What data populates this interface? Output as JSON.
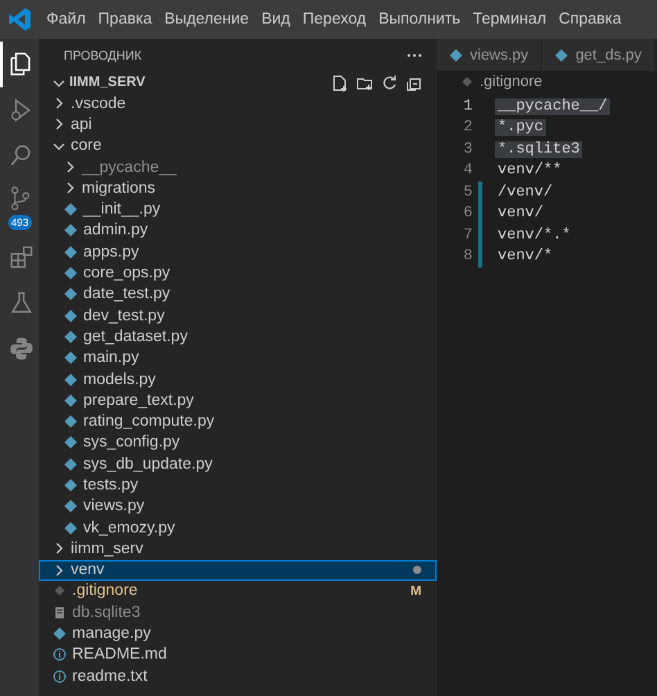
{
  "menu": [
    "Файл",
    "Правка",
    "Выделение",
    "Вид",
    "Переход",
    "Выполнить",
    "Терминал",
    "Справка"
  ],
  "activity_bar": [
    {
      "kind": "explorer",
      "selected": true
    },
    {
      "kind": "debug",
      "selected": false
    },
    {
      "kind": "search",
      "selected": false
    },
    {
      "kind": "scm",
      "selected": false,
      "badge": "493"
    },
    {
      "kind": "extensions",
      "selected": false
    },
    {
      "kind": "testing",
      "selected": false
    },
    {
      "kind": "python",
      "selected": false
    }
  ],
  "explorer": {
    "title": "ПРОВОДНИК",
    "folder": "IIMM_SERV",
    "items": [
      {
        "name": ".vscode",
        "kind": "folder",
        "expanded": false,
        "selected": false,
        "ignored": false,
        "modified": false,
        "dot": false
      },
      {
        "name": "api",
        "kind": "folder",
        "expanded": false,
        "selected": false,
        "ignored": false,
        "modified": false,
        "dot": false
      },
      {
        "name": "core",
        "kind": "folder",
        "expanded": true,
        "selected": false,
        "ignored": false,
        "modified": false,
        "dot": false,
        "children": [
          {
            "name": "__pycache__",
            "kind": "folder",
            "expanded": false,
            "selected": false,
            "ignored": true,
            "modified": false,
            "dot": false
          },
          {
            "name": "migrations",
            "kind": "folder",
            "expanded": false,
            "selected": false,
            "ignored": false,
            "modified": false,
            "dot": false
          },
          {
            "name": "__init__.py",
            "kind": "python",
            "selected": false,
            "ignored": false,
            "modified": false,
            "dot": false
          },
          {
            "name": "admin.py",
            "kind": "python",
            "selected": false,
            "ignored": false,
            "modified": false,
            "dot": false
          },
          {
            "name": "apps.py",
            "kind": "python",
            "selected": false,
            "ignored": false,
            "modified": false,
            "dot": false
          },
          {
            "name": "core_ops.py",
            "kind": "python",
            "selected": false,
            "ignored": false,
            "modified": false,
            "dot": false
          },
          {
            "name": "date_test.py",
            "kind": "python",
            "selected": false,
            "ignored": false,
            "modified": false,
            "dot": false
          },
          {
            "name": "dev_test.py",
            "kind": "python",
            "selected": false,
            "ignored": false,
            "modified": false,
            "dot": false
          },
          {
            "name": "get_dataset.py",
            "kind": "python",
            "selected": false,
            "ignored": false,
            "modified": false,
            "dot": false
          },
          {
            "name": "main.py",
            "kind": "python",
            "selected": false,
            "ignored": false,
            "modified": false,
            "dot": false
          },
          {
            "name": "models.py",
            "kind": "python",
            "selected": false,
            "ignored": false,
            "modified": false,
            "dot": false
          },
          {
            "name": "prepare_text.py",
            "kind": "python",
            "selected": false,
            "ignored": false,
            "modified": false,
            "dot": false
          },
          {
            "name": "rating_compute.py",
            "kind": "python",
            "selected": false,
            "ignored": false,
            "modified": false,
            "dot": false
          },
          {
            "name": "sys_config.py",
            "kind": "python",
            "selected": false,
            "ignored": false,
            "modified": false,
            "dot": false
          },
          {
            "name": "sys_db_update.py",
            "kind": "python",
            "selected": false,
            "ignored": false,
            "modified": false,
            "dot": false
          },
          {
            "name": "tests.py",
            "kind": "python",
            "selected": false,
            "ignored": false,
            "modified": false,
            "dot": false
          },
          {
            "name": "views.py",
            "kind": "python",
            "selected": false,
            "ignored": false,
            "modified": false,
            "dot": false
          },
          {
            "name": "vk_emozy.py",
            "kind": "python",
            "selected": false,
            "ignored": false,
            "modified": false,
            "dot": false
          }
        ]
      },
      {
        "name": "iimm_serv",
        "kind": "folder",
        "expanded": false,
        "selected": false,
        "ignored": false,
        "modified": false,
        "dot": false
      },
      {
        "name": "venv",
        "kind": "folder",
        "expanded": false,
        "selected": true,
        "ignored": false,
        "modified": false,
        "dot": true
      },
      {
        "name": ".gitignore",
        "kind": "gitignore",
        "selected": false,
        "ignored": false,
        "modified": true,
        "badge": "M",
        "dot": false
      },
      {
        "name": "db.sqlite3",
        "kind": "database",
        "selected": false,
        "ignored": true,
        "modified": false,
        "dot": false
      },
      {
        "name": "manage.py",
        "kind": "python",
        "selected": false,
        "ignored": false,
        "modified": false,
        "dot": false
      },
      {
        "name": "README.md",
        "kind": "info",
        "selected": false,
        "ignored": false,
        "modified": false,
        "dot": false
      },
      {
        "name": "readme.txt",
        "kind": "info",
        "selected": false,
        "ignored": false,
        "modified": false,
        "dot": false
      }
    ]
  },
  "tabs": [
    {
      "label": "views.py",
      "selected": false
    },
    {
      "label": "get_ds.py",
      "selected": false
    }
  ],
  "breadcrumb": ".gitignore",
  "lines": [
    {
      "number": "1",
      "text": "__pycache__/",
      "selected": true,
      "current": true,
      "added": false
    },
    {
      "number": "2",
      "text": "*.pyc",
      "selected": true,
      "current": false,
      "added": false
    },
    {
      "number": "3",
      "text": "*.sqlite3",
      "selected": true,
      "current": false,
      "added": false
    },
    {
      "number": "4",
      "text": "venv/**",
      "selected": false,
      "current": false,
      "added": false
    },
    {
      "number": "5",
      "text": "/venv/",
      "selected": false,
      "current": false,
      "added": true
    },
    {
      "number": "6",
      "text": "venv/",
      "selected": false,
      "current": false,
      "added": true
    },
    {
      "number": "7",
      "text": "venv/*.*",
      "selected": false,
      "current": false,
      "added": true
    },
    {
      "number": "8",
      "text": "venv/*",
      "selected": false,
      "current": false,
      "added": true
    }
  ]
}
